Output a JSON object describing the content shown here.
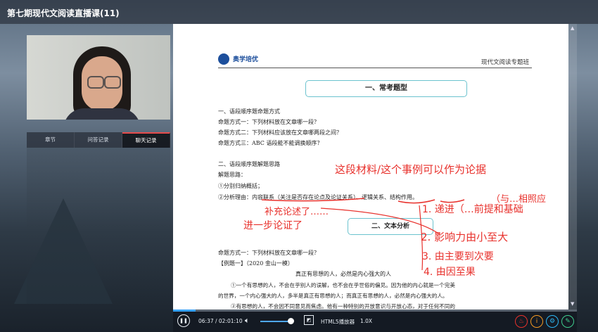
{
  "window": {
    "title": "第七期现代文阅读直播课(11)"
  },
  "panel_tabs": [
    "章节",
    "问答记录",
    "聊天记录"
  ],
  "document": {
    "logo": "奥学培优",
    "header": "现代文阅读专题班",
    "section1_title": "一、常考题型",
    "lines": [
      "一、语段顺序题命题方式",
      "命题方式一：下列材料放在文章哪一段？",
      "命题方式二：下列材料应该放在文章哪两段之间？",
      "命题方式三：ABC 语段能不能调换顺序？",
      "二、语段顺序题解题思路",
      "解题思路：",
      "①分别归纳概括；",
      "②分析理由：内容联系（关注是否存在论点及论证关系）、逻辑关系、结构作用。",
      "命题方式一：下列材料放在文章哪一段？",
      "【例题一】（2020 金山一模）",
      "真正有思想的人，必然是内心强大的人",
      "①一个有思想的人，不会在乎别人的误解，也不会在乎世俗的偏见。因为他的内心就是一个完美",
      "的世界，一个内心强大的人，多半是真正有思想的人；而真正有思想的人，必然是内心强大的人。",
      "②有思想的人，不会因不同意见而焦虑。他有一种特别的开放意识与开放心态，对于任何不同的"
    ],
    "section2_title": "二、文本分析",
    "annotations": [
      "这段材料/这个事例可以作为论据",
      "（与…相照应",
      "补充论述了……",
      "1. 递进（…前提和基础",
      "进一步论证了",
      "2. 影响力由小至大",
      "3. 由主要到次要",
      "4. 由因至果"
    ]
  },
  "player": {
    "time": "06:37 / 02:01:10",
    "progress": 0.055,
    "volume": 0.85,
    "player_label": "HTML5播放器",
    "speed": "1.0X"
  },
  "colors": {
    "annotation": "#e8312c",
    "accent": "#38a3ff",
    "box_border": "#6cc3cf"
  }
}
